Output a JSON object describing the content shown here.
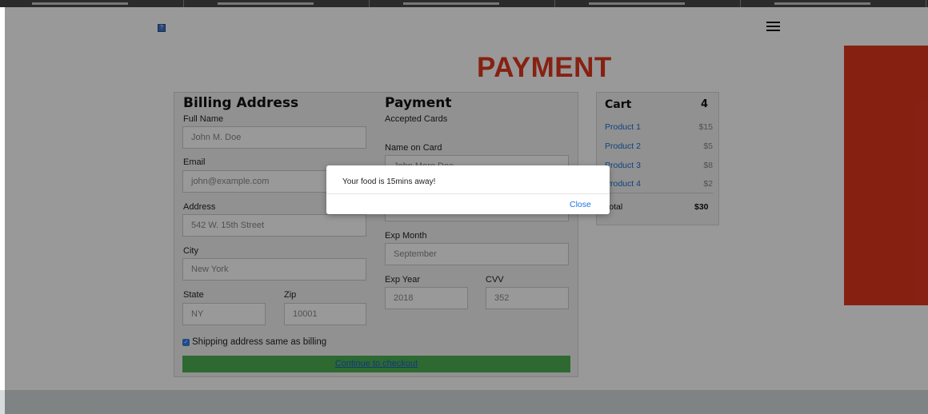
{
  "page": {
    "title": "PAYMENT"
  },
  "billing": {
    "heading": "Billing Address",
    "full_name_label": "Full Name",
    "full_name_value": "John M. Doe",
    "email_label": "Email",
    "email_value": "john@example.com",
    "address_label": "Address",
    "address_value": "542 W. 15th Street",
    "city_label": "City",
    "city_value": "New York",
    "state_label": "State",
    "state_value": "NY",
    "zip_label": "Zip",
    "zip_value": "10001"
  },
  "payment": {
    "heading": "Payment",
    "accepted_label": "Accepted Cards",
    "name_on_card_label": "Name on Card",
    "name_on_card_value": "John More Doe",
    "exp_month_label": "Exp Month",
    "exp_month_value": "September",
    "exp_year_label": "Exp Year",
    "exp_year_value": "2018",
    "cvv_label": "CVV",
    "cvv_value": "352"
  },
  "form": {
    "shipping_checkbox_label": "Shipping address same as billing",
    "shipping_checked": true,
    "checkout_button": "Continue to checkout"
  },
  "cart": {
    "heading": "Cart",
    "count": "4",
    "items": [
      {
        "name": "Product 1",
        "price": "$15"
      },
      {
        "name": "Product 2",
        "price": "$5"
      },
      {
        "name": "Product 3",
        "price": "$8"
      },
      {
        "name": "Product 4",
        "price": "$2"
      }
    ],
    "total_label": "Total",
    "total_value": "$30"
  },
  "modal": {
    "message": "Your food is 15mins away!",
    "close_label": "Close"
  },
  "colors": {
    "accent_red": "#e0371f",
    "button_green": "#4caf50",
    "link_blue": "#1a73e8"
  }
}
